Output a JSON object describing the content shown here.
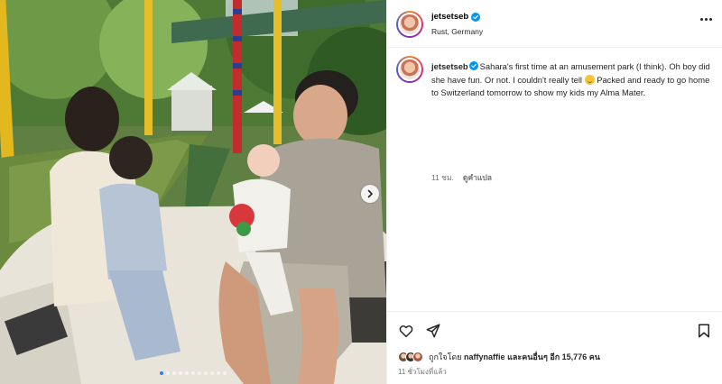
{
  "post": {
    "username": "jetsetseb",
    "location": "Rust, Germany",
    "caption_username": "jetsetseb",
    "caption_text_1": "Sahara's first time at an amusement park (I think). Oh boy did she have fun. Or not. I couldn't really tell",
    "caption_text_2": " Packed and ready to go home to Switzerland tomorrow to show my kids my Alma Mater.",
    "comment_time": "11 ชม.",
    "translate_label": "ดูคำแปล",
    "liked_by_prefix": "ถูกใจโดย",
    "liked_by_user": "naffynaffie",
    "liked_by_middle": "และคนอื่นๆ",
    "liked_by_count": "อีก 15,776 คน",
    "posted_ago": "11 ชั่วโมงที่แล้ว"
  },
  "carousel": {
    "total": 11,
    "active": 0
  },
  "icons": {
    "verified": "verified-badge-icon",
    "more": "more-options-icon",
    "like": "heart-icon",
    "share": "send-icon",
    "save": "bookmark-icon",
    "next": "chevron-right-icon"
  },
  "colors": {
    "verified": "#0095f6",
    "text": "#262626",
    "muted": "#737373",
    "active_dot": "#2f80ed"
  }
}
